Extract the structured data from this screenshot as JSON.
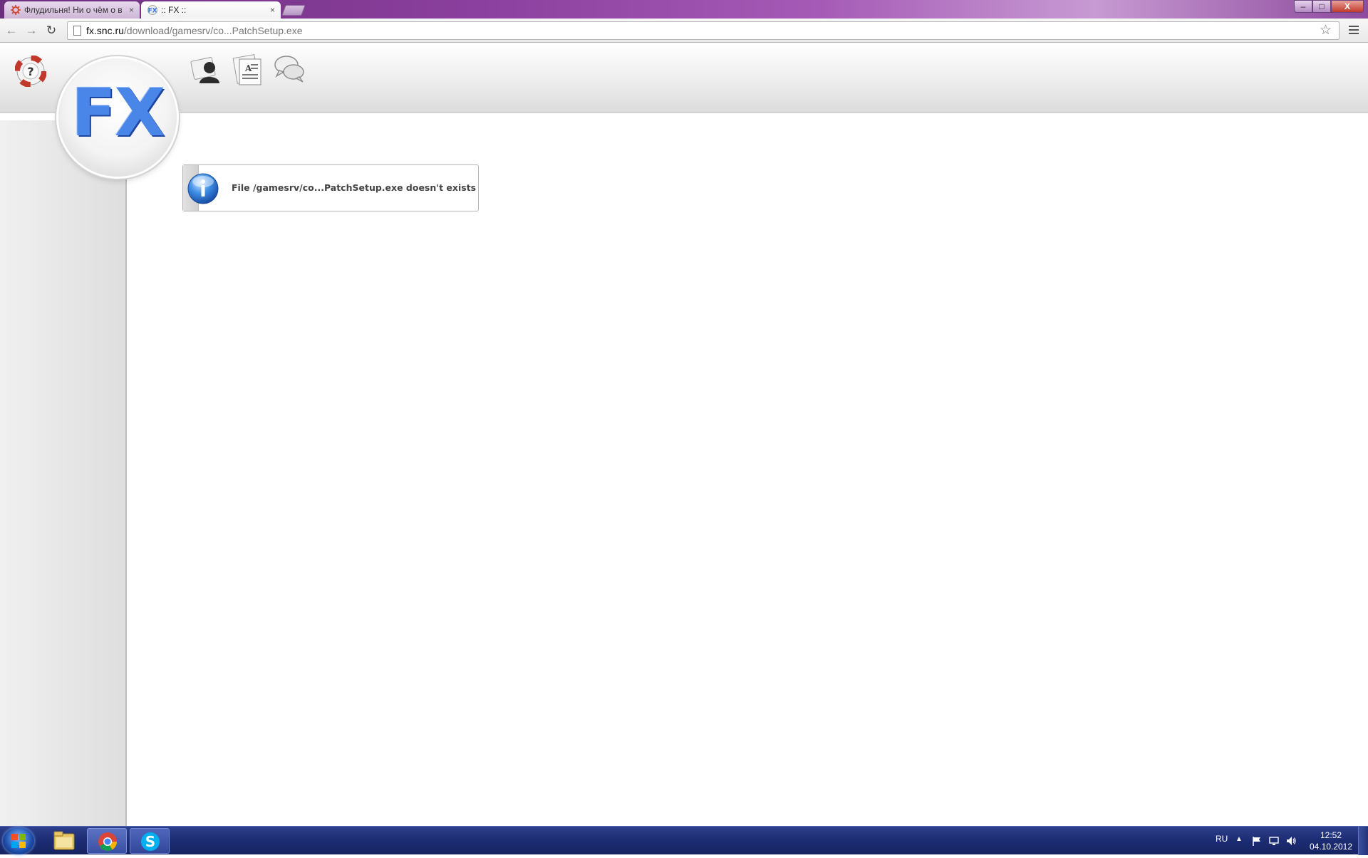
{
  "browser": {
    "tabs": [
      {
        "title": "Флудильня! Ни о чём о в",
        "active": false,
        "favicon": "gear-favicon-icon"
      },
      {
        "title": ":: FX ::",
        "active": true,
        "favicon": "fx-favicon-icon"
      }
    ],
    "tab_close_symbol": "×",
    "address": {
      "host": "fx.snc.ru",
      "path": "/download/gamesrv/co...PatchSetup.exe"
    },
    "nav": {
      "back": "←",
      "forward": "→",
      "reload": "↻",
      "star": "☆"
    },
    "window_controls": {
      "minimize": "–",
      "maximize": "□",
      "close": "X"
    }
  },
  "site": {
    "logo_text": "FX",
    "header_icons": [
      "help-lifebuoy-icon",
      "profile-icon",
      "news-icon",
      "chat-icon"
    ],
    "message": {
      "icon": "info-icon",
      "text": "File /gamesrv/co...PatchSetup.exe doesn't exists"
    }
  },
  "taskbar": {
    "pinned": [
      "windows-start-icon",
      "explorer-icon",
      "chrome-icon",
      "skype-icon"
    ],
    "language": "RU",
    "tray_arrow": "▲",
    "time": "12:52",
    "date": "04.10.2012"
  },
  "colors": {
    "logo_blue": "#4a86e8",
    "titlebar_purple": "#8b3f9e",
    "taskbar_blue": "#1c2c73"
  }
}
